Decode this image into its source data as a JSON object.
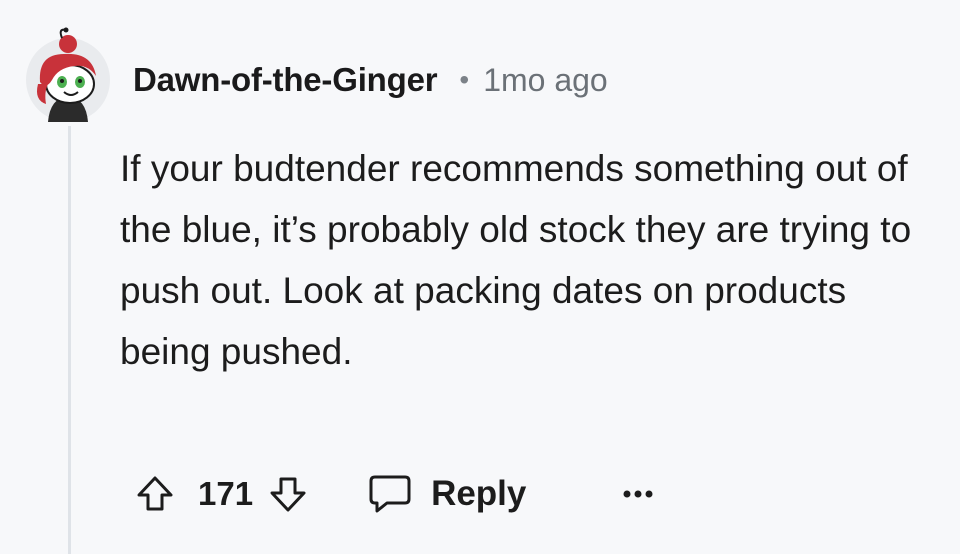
{
  "comment": {
    "username": "Dawn-of-the-Ginger",
    "separator": "•",
    "timestamp": "1mo ago",
    "body": "If your budtender recommends something out of the blue, it’s probably old stock they are trying to push out. Look at packing dates on products being pushed."
  },
  "actions": {
    "upvote_icon": "arrow-up-outline-icon",
    "score": "171",
    "downvote_icon": "arrow-down-outline-icon",
    "reply_icon": "speech-bubble-icon",
    "reply_label": "Reply",
    "more_icon": "ellipsis-icon"
  },
  "avatar": {
    "icon": "snoo-avatar-red-hair",
    "hair_color": "#c8323a",
    "eye_color": "#4caf50"
  },
  "colors": {
    "background": "#f7f8fa",
    "text": "#1c1c1c",
    "muted": "#6b7177",
    "thread_line": "#dfe3e8"
  }
}
